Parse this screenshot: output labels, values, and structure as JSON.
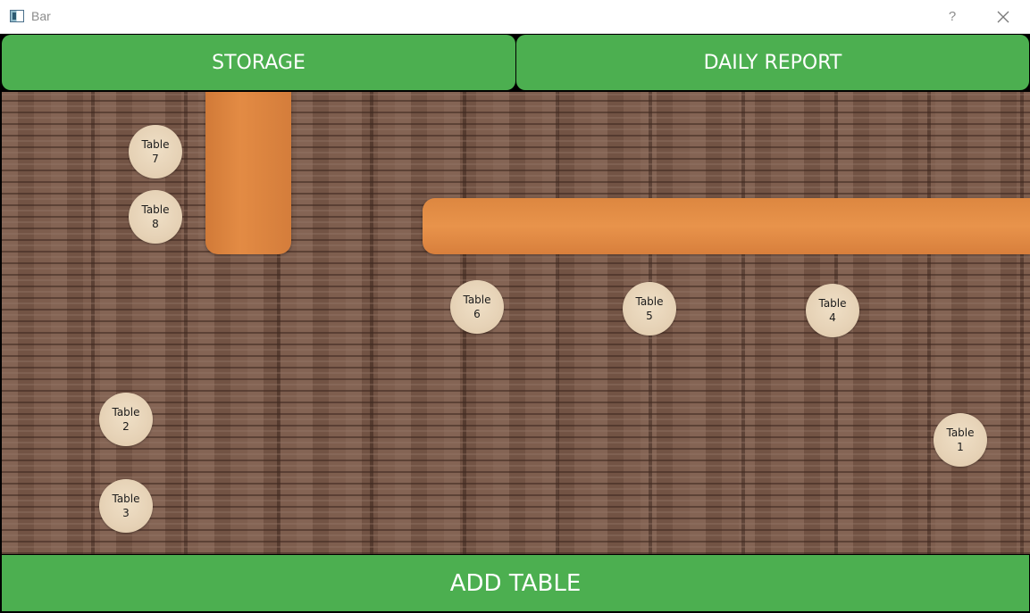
{
  "window": {
    "title": "Bar",
    "help_label": "?",
    "icon": "app-window-icon",
    "close_icon": "close-icon"
  },
  "toolbar": {
    "storage_label": "STORAGE",
    "daily_report_label": "DAILY REPORT"
  },
  "tables": [
    {
      "word": "Table",
      "number": "1"
    },
    {
      "word": "Table",
      "number": "2"
    },
    {
      "word": "Table",
      "number": "3"
    },
    {
      "word": "Table",
      "number": "4"
    },
    {
      "word": "Table",
      "number": "5"
    },
    {
      "word": "Table",
      "number": "6"
    },
    {
      "word": "Table",
      "number": "7"
    },
    {
      "word": "Table",
      "number": "8"
    }
  ],
  "footer": {
    "add_table_label": "ADD TABLE"
  },
  "colors": {
    "button_green": "#4caf50",
    "counter_orange": "#e38b44",
    "table_beige": "#e6d2b6"
  }
}
